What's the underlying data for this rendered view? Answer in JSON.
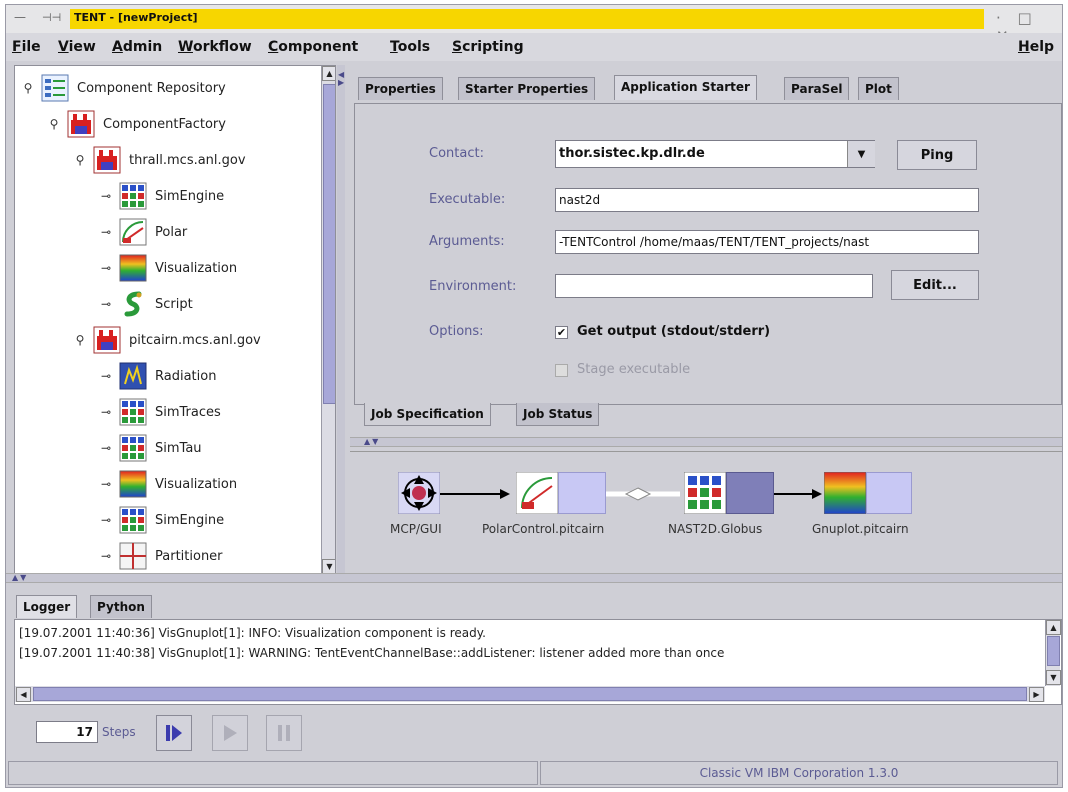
{
  "window": {
    "title": "TENT - [newProject]",
    "controls": "· □ ✕"
  },
  "menu": {
    "items": [
      "File",
      "View",
      "Admin",
      "Workflow",
      "Component",
      "Tools",
      "Scripting"
    ],
    "help": "Help"
  },
  "tree": {
    "root": "Component Repository",
    "factory": "ComponentFactory",
    "host1": "thrall.mcs.anl.gov",
    "host1_children": [
      "SimEngine",
      "Polar",
      "Visualization",
      "Script"
    ],
    "host2": "pitcairn.mcs.anl.gov",
    "host2_children": [
      "Radiation",
      "SimTraces",
      "SimTau",
      "Visualization",
      "SimEngine",
      "Partitioner"
    ]
  },
  "top_tabs": [
    "Properties",
    "Starter Properties",
    "Application Starter",
    "ParaSel",
    "Plot"
  ],
  "active_top_tab": "Application Starter",
  "starter": {
    "contact_label": "Contact:",
    "contact_value": "thor.sistec.kp.dlr.de",
    "ping_label": "Ping",
    "executable_label": "Executable:",
    "executable_value": "nast2d",
    "arguments_label": "Arguments:",
    "arguments_value": "-TENTControl /home/maas/TENT/TENT_projects/nast",
    "environment_label": "Environment:",
    "environment_value": "",
    "edit_label": "Edit...",
    "options_label": "Options:",
    "get_output_label": "Get output (stdout/stderr)",
    "get_output_checked": true,
    "stage_exec_label": "Stage executable",
    "stage_exec_checked": false
  },
  "sub_tabs": [
    "Job Specification",
    "Job Status"
  ],
  "workflow": {
    "nodes": [
      "MCP/GUI",
      "PolarControl.pitcairn",
      "NAST2D.Globus",
      "Gnuplot.pitcairn"
    ]
  },
  "logger": {
    "tabs": [
      "Logger",
      "Python"
    ],
    "lines": [
      "[19.07.2001 11:40:36] VisGnuplot[1]: INFO: Visualization component is ready.",
      "[19.07.2001 11:40:38] VisGnuplot[1]: WARNING: TentEventChannelBase::addListener: listener added more than once"
    ]
  },
  "steps": {
    "value": "17",
    "label": "Steps"
  },
  "status": {
    "left": "",
    "right": "Classic VM IBM Corporation 1.3.0"
  },
  "colors": {
    "title_highlight": "#f7d600",
    "scroll_thumb": "#a7a7d8",
    "label_text": "#5b5b93"
  }
}
